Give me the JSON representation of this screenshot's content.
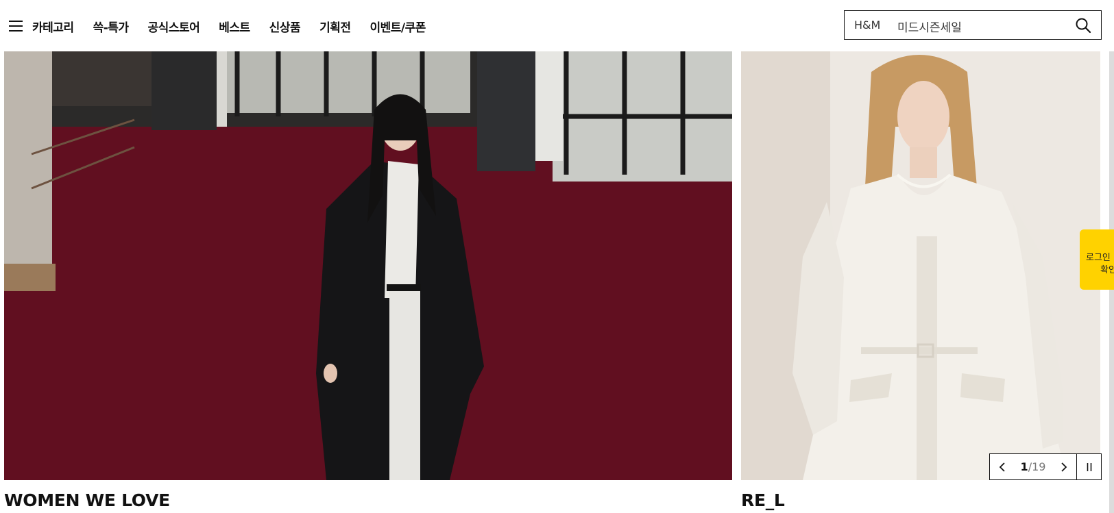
{
  "header": {
    "nav": [
      "카테고리",
      "쓱-특가",
      "공식스토어",
      "베스트",
      "신상품",
      "기획전",
      "이벤트/쿠폰"
    ]
  },
  "search": {
    "brand": "H&M",
    "keyword": "미드시즌세일"
  },
  "banners": [
    {
      "title": "WOMEN WE LOVE"
    },
    {
      "title": "RE_L"
    }
  ],
  "pager": {
    "current": "1",
    "separator": "/",
    "total": "19"
  },
  "login_tab": {
    "line1": "로그인",
    "line2": "확인"
  },
  "colors": {
    "accent": "#ffd200",
    "text": "#111111",
    "carpet": "#5e0f1f"
  }
}
